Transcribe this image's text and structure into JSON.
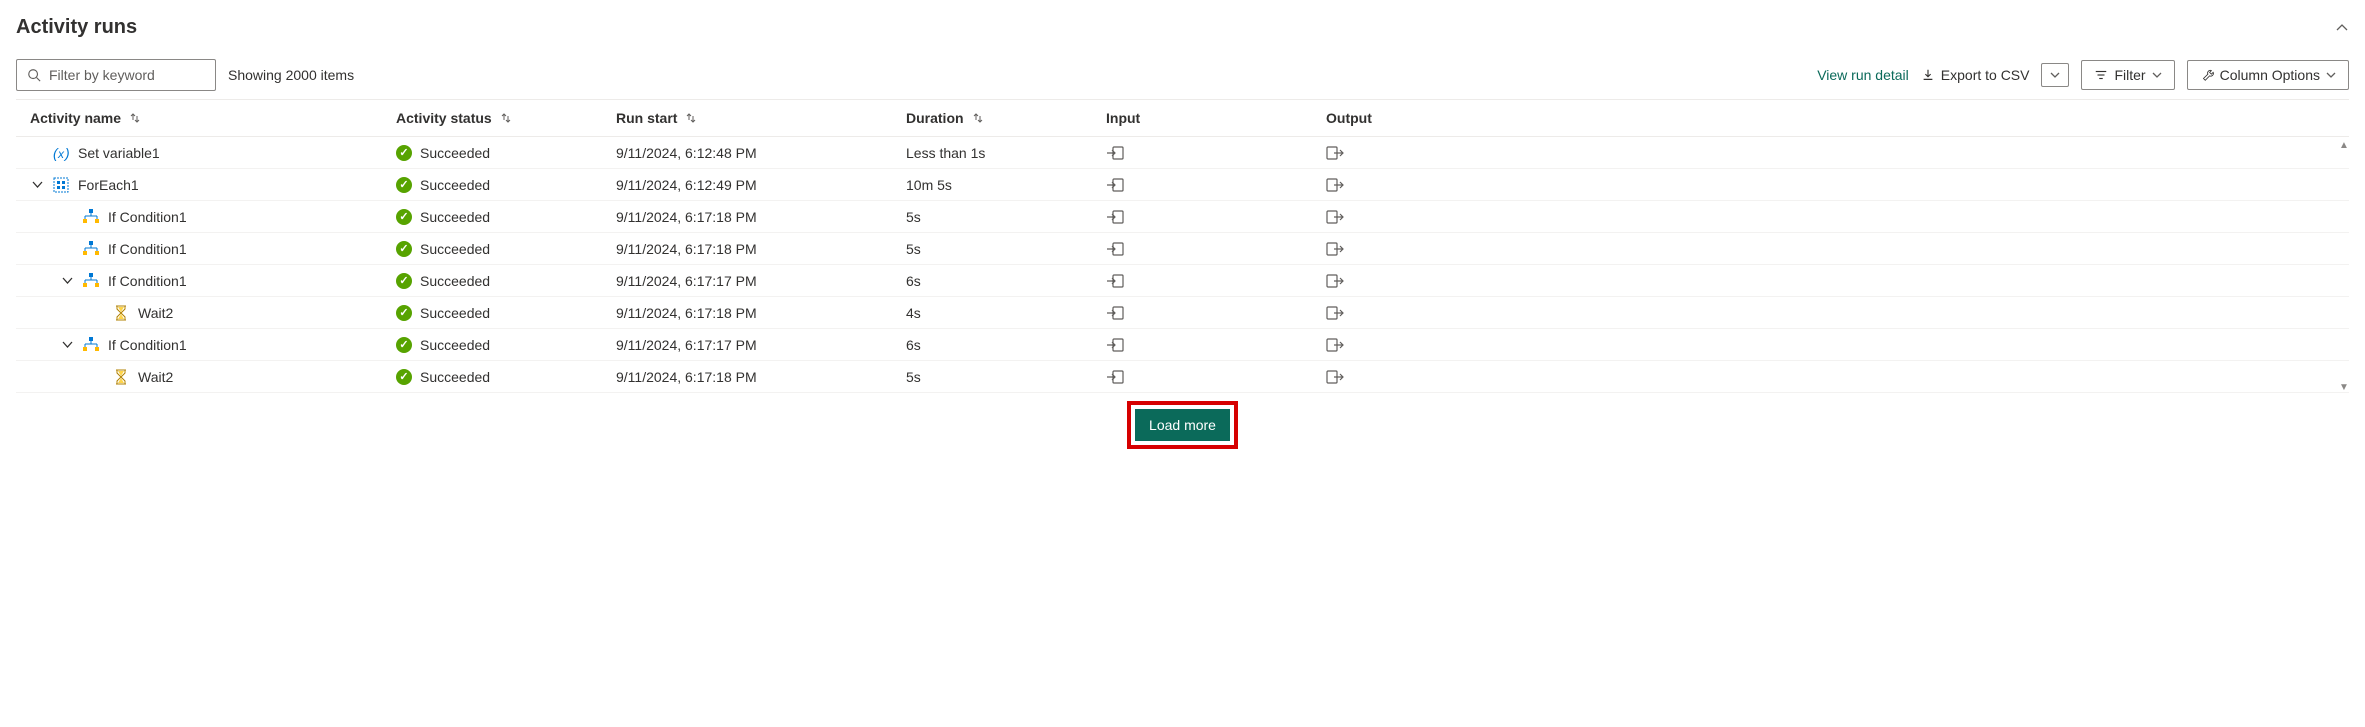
{
  "title": "Activity runs",
  "toolbar": {
    "filter_placeholder": "Filter by keyword",
    "items_count": "Showing 2000 items",
    "view_detail": "View run detail",
    "export_csv": "Export to CSV",
    "filter_btn": "Filter",
    "column_options": "Column Options",
    "load_more": "Load more"
  },
  "columns": {
    "name": "Activity name",
    "status": "Activity status",
    "start": "Run start",
    "duration": "Duration",
    "input": "Input",
    "output": "Output"
  },
  "status_label": "Succeeded",
  "rows": [
    {
      "indent": 0,
      "chevron": "",
      "icon": "variable",
      "name": "Set variable1",
      "start": "9/11/2024, 6:12:48 PM",
      "duration": "Less than 1s"
    },
    {
      "indent": 0,
      "chevron": "down",
      "icon": "foreach",
      "name": "ForEach1",
      "start": "9/11/2024, 6:12:49 PM",
      "duration": "10m 5s"
    },
    {
      "indent": 1,
      "chevron": "",
      "icon": "if",
      "name": "If Condition1",
      "start": "9/11/2024, 6:17:18 PM",
      "duration": "5s"
    },
    {
      "indent": 1,
      "chevron": "",
      "icon": "if",
      "name": "If Condition1",
      "start": "9/11/2024, 6:17:18 PM",
      "duration": "5s"
    },
    {
      "indent": 1,
      "chevron": "down",
      "icon": "if",
      "name": "If Condition1",
      "start": "9/11/2024, 6:17:17 PM",
      "duration": "6s"
    },
    {
      "indent": 2,
      "chevron": "",
      "icon": "wait",
      "name": "Wait2",
      "start": "9/11/2024, 6:17:18 PM",
      "duration": "4s"
    },
    {
      "indent": 1,
      "chevron": "down",
      "icon": "if",
      "name": "If Condition1",
      "start": "9/11/2024, 6:17:17 PM",
      "duration": "6s"
    },
    {
      "indent": 2,
      "chevron": "",
      "icon": "wait",
      "name": "Wait2",
      "start": "9/11/2024, 6:17:18 PM",
      "duration": "5s"
    }
  ]
}
